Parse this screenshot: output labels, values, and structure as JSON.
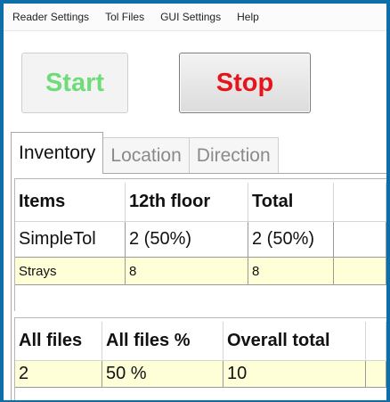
{
  "menubar": {
    "items": [
      "Reader Settings",
      "Tol Files",
      "GUI Settings",
      "Help"
    ]
  },
  "controls": {
    "start_label": "Start",
    "stop_label": "Stop"
  },
  "tabs": [
    "Inventory",
    "Location",
    "Direction"
  ],
  "colors": {
    "window_border": "#0e6ea8",
    "start_text": "#6fdc7a",
    "stop_text": "#e6141b",
    "highlight_row": "#fefed7"
  },
  "inventory_table": {
    "headers": [
      "Items",
      "12th floor",
      "Total"
    ],
    "rows": [
      [
        "SimpleTol",
        "2 (50%)",
        "2 (50%)"
      ],
      [
        "Strays",
        "8",
        "8"
      ]
    ]
  },
  "summary_table": {
    "headers": [
      "All files",
      "All files %",
      "Overall total"
    ],
    "rows": [
      [
        "2",
        "50 %",
        "10"
      ]
    ]
  }
}
